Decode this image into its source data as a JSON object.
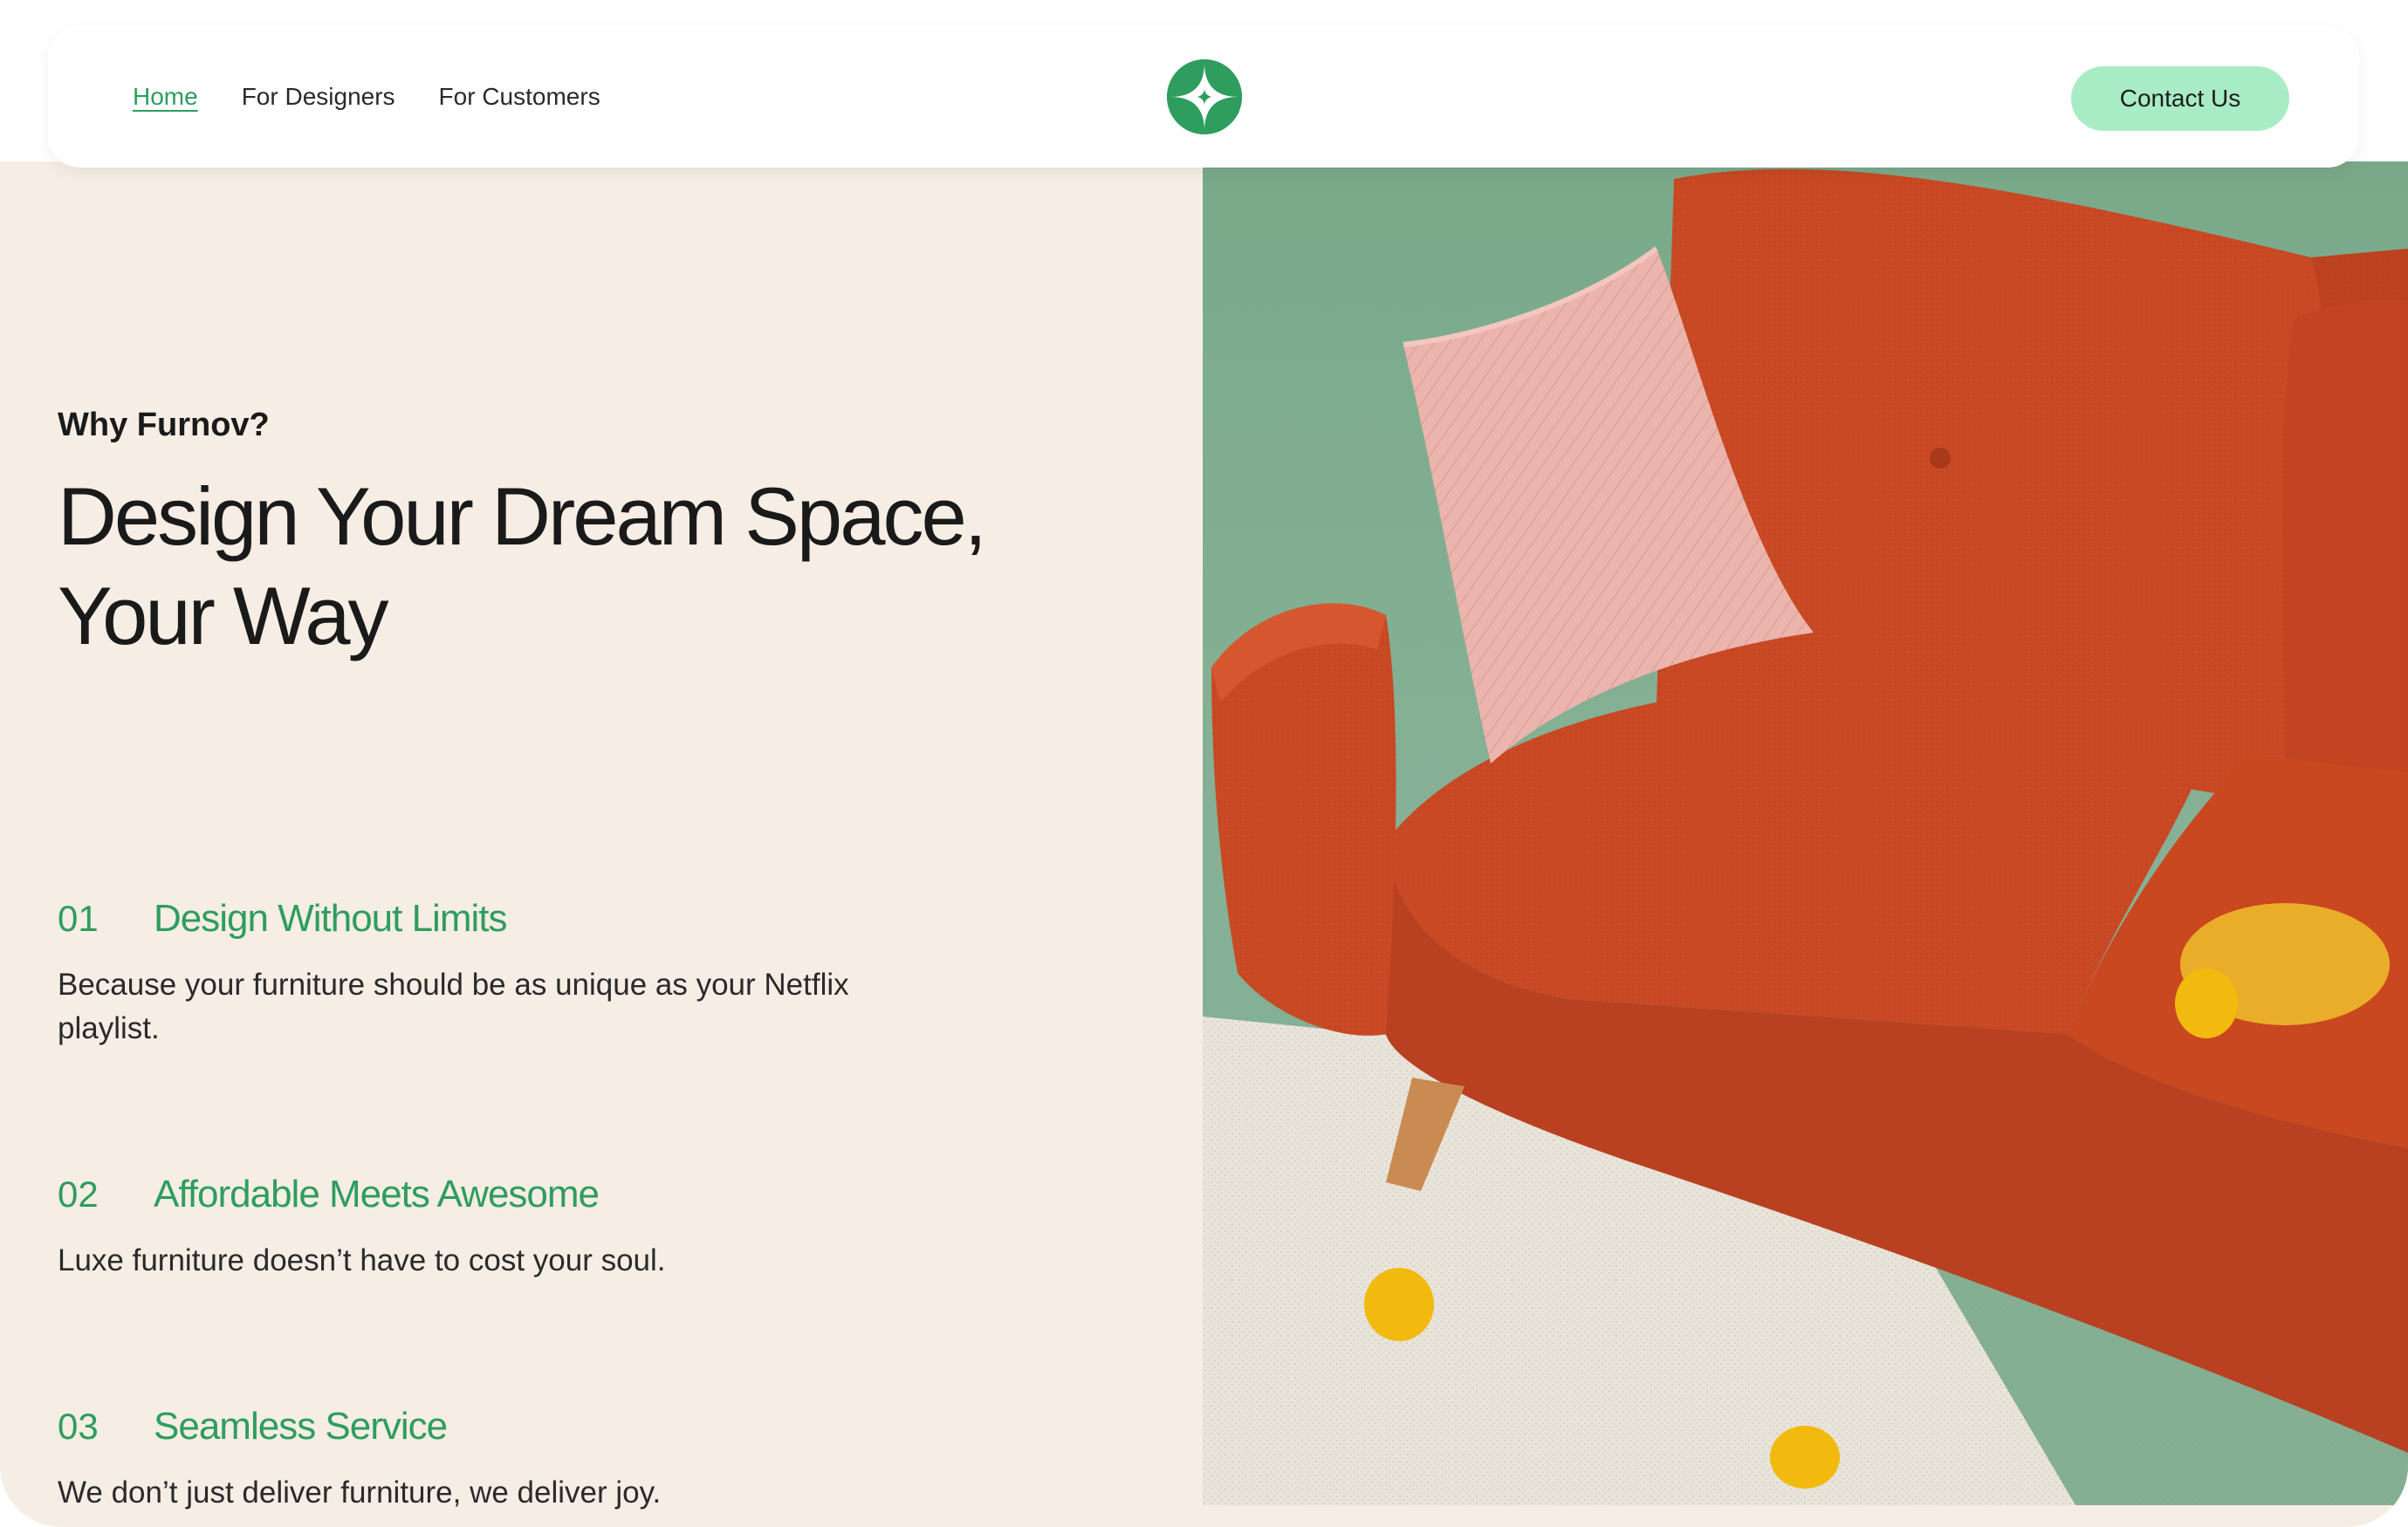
{
  "nav": {
    "items": [
      {
        "label": "Home",
        "active": true
      },
      {
        "label": "For Designers",
        "active": false
      },
      {
        "label": "For Customers",
        "active": false
      }
    ],
    "contact_label": "Contact Us",
    "logo_icon": "sparkle-logo-icon"
  },
  "hero": {
    "eyebrow": "Why Furnov?",
    "headline_line1": "Design Your Dream Space,",
    "headline_line2": "Your Way"
  },
  "features": [
    {
      "num": "01",
      "title": "Design Without Limits",
      "desc": "Because your furniture should be as unique as your Netflix playlist."
    },
    {
      "num": "02",
      "title": "Affordable Meets Awesome",
      "desc": "Luxe furniture doesn’t have to cost your soul."
    },
    {
      "num": "03",
      "title": "Seamless Service",
      "desc": "We don’t just deliver furniture, we deliver joy."
    }
  ],
  "colors": {
    "accent": "#2e9d5e",
    "button": "#a8ecc5",
    "page_bg": "#f6ede5",
    "sofa": "#c94a25",
    "pillow": "#eab1aa",
    "wall": "#7ea98b"
  },
  "image": {
    "subject": "orange-sofa-photo"
  }
}
